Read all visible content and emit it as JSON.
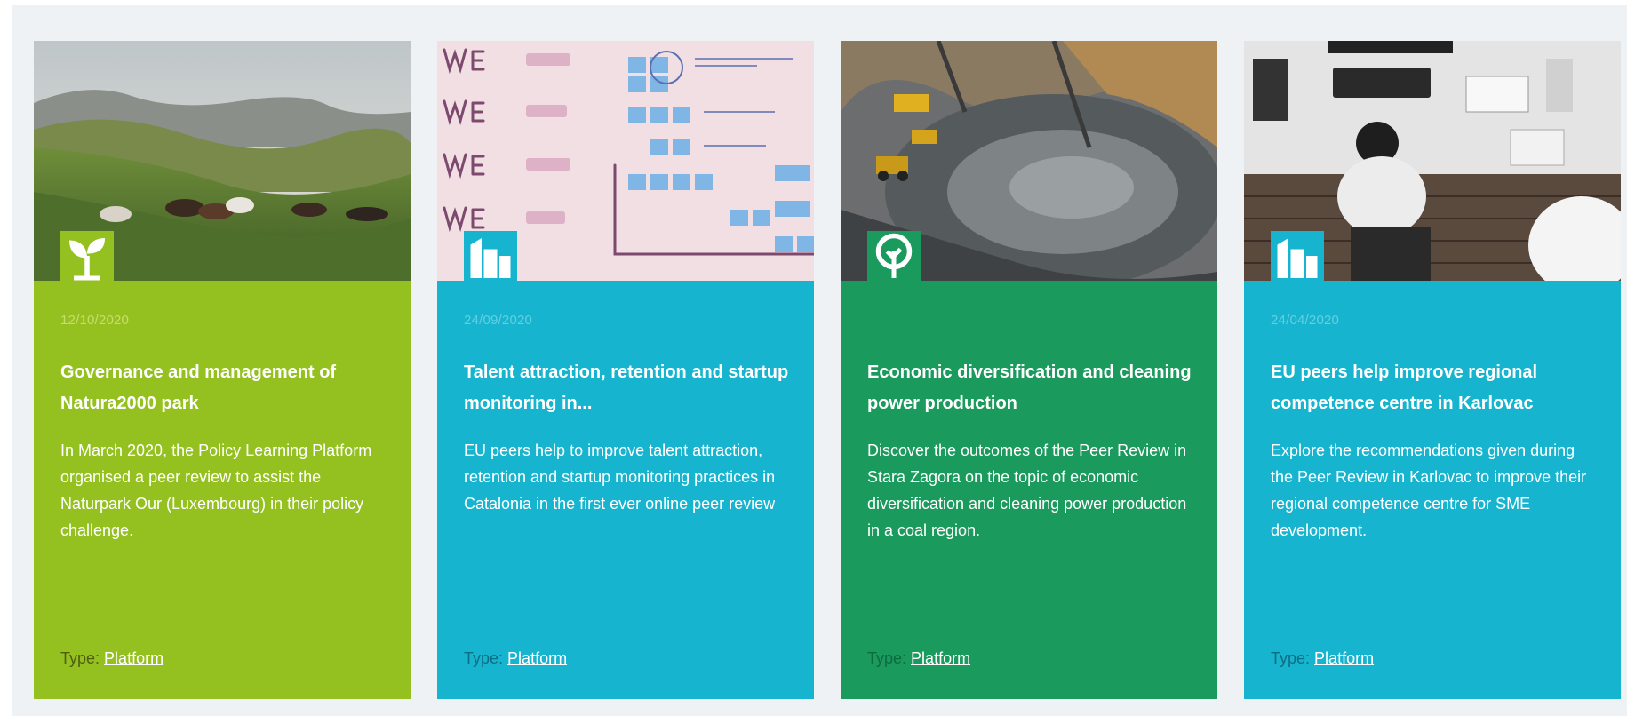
{
  "colors": {
    "panel_bg": "#eef2f5",
    "lime": "#94c11f",
    "teal": "#17b4d0",
    "green": "#1a9a5c"
  },
  "cards": [
    {
      "theme": "lime",
      "icon": "sprout-icon",
      "date": "12/10/2020",
      "title": "Governance and management of Natura2000 park",
      "description": "In March 2020, the Policy Learning Platform organised a peer review to assist the Naturpark Our (Luxembourg) in their policy challenge.",
      "type_label": "Type:",
      "type_link": "Platform"
    },
    {
      "theme": "teal",
      "icon": "buildings-icon",
      "date": "24/09/2020",
      "title": "Talent attraction, retention and startup monitoring in...",
      "description": "EU peers help to improve talent attraction, retention and startup monitoring practices in Catalonia in the first ever online peer review",
      "type_label": "Type:",
      "type_link": "Platform"
    },
    {
      "theme": "green",
      "icon": "tree-icon",
      "date": "",
      "title": "Economic diversification and cleaning power production",
      "description": "Discover the outcomes of the Peer Review in Stara Zagora on the topic of economic diversification and cleaning power production in a coal region.",
      "type_label": "Type:",
      "type_link": "Platform"
    },
    {
      "theme": "teal",
      "icon": "buildings-icon",
      "date": "24/04/2020",
      "title": "EU peers help improve regional competence centre in Karlovac",
      "description": "Explore the recommendations given during the Peer Review in Karlovac to improve their regional competence centre for SME development.",
      "type_label": "Type:",
      "type_link": "Platform"
    }
  ]
}
